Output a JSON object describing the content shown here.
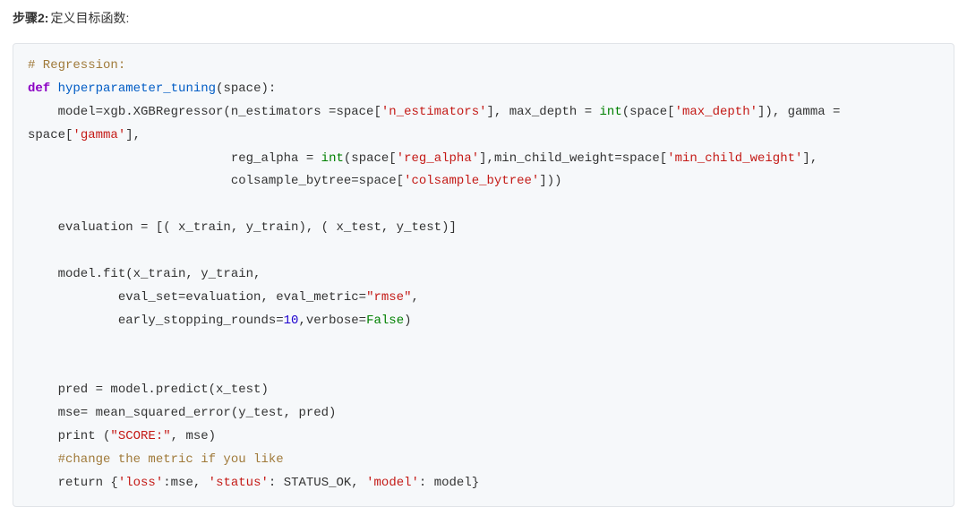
{
  "heading": {
    "step_label": "步骤2:",
    "step_desc": "定义目标函数:"
  },
  "code": {
    "t_reg_comment": "# Regression:",
    "t_def": "def",
    "t_funcname": "hyperparameter_tuning",
    "t_sig_rest": "(space):",
    "t_model_assign": "    model=xgb.XGBRegressor(n_estimators =space[",
    "s_n_estimators": "'n_estimators'",
    "t_maxdepth1": "], max_depth = ",
    "t_int": "int",
    "t_open_paren": "(",
    "t_space_l": "space[",
    "s_max_depth": "'max_depth'",
    "t_close_br": "]",
    "t_close_paren": ")",
    "t_gamma_label": ", gamma =",
    "t_newline_wrap": " ",
    "t_space_gamma": "space[",
    "s_gamma": "'gamma'",
    "t_gamma_close": "],",
    "t_pad27": "                           ",
    "t_reg_alpha_label": "reg_alpha = ",
    "s_reg_alpha": "'reg_alpha'",
    "t_min_child": ",min_child_weight=space[",
    "s_min_child": "'min_child_weight'",
    "t_min_child_close": "],",
    "t_colsample": "colsample_bytree=space[",
    "s_colsample": "'colsample_bytree'",
    "t_col_close": "]))",
    "t_blank": "",
    "t_eval": "    evaluation = [( x_train, y_train), ( x_test, y_test)]",
    "t_fit1": "    model.fit(x_train, y_train,",
    "t_fit2a": "            eval_set=evaluation, eval_metric=",
    "s_rmse": "\"rmse\"",
    "t_fit2b": ",",
    "t_fit3a": "            early_stopping_rounds=",
    "n_ten": "10",
    "t_fit3b": ",verbose=",
    "t_false": "False",
    "t_close_paren2": ")",
    "t_pred": "    pred = model.predict(x_test)",
    "t_mse": "    mse= mean_squared_error(y_test, pred)",
    "t_print": "    print ",
    "t_open_paren2": "(",
    "s_score": "\"SCORE:\"",
    "t_print_rest": ", mse)",
    "t_change_comment": "    #change the metric if you like",
    "t_return": "    return ",
    "t_open_brace": "{",
    "s_loss": "'loss'",
    "t_colon_mse": ":mse, ",
    "s_status": "'status'",
    "t_colon_status": ": STATUS_OK, ",
    "s_model": "'model'",
    "t_colon_model": ": model}"
  }
}
